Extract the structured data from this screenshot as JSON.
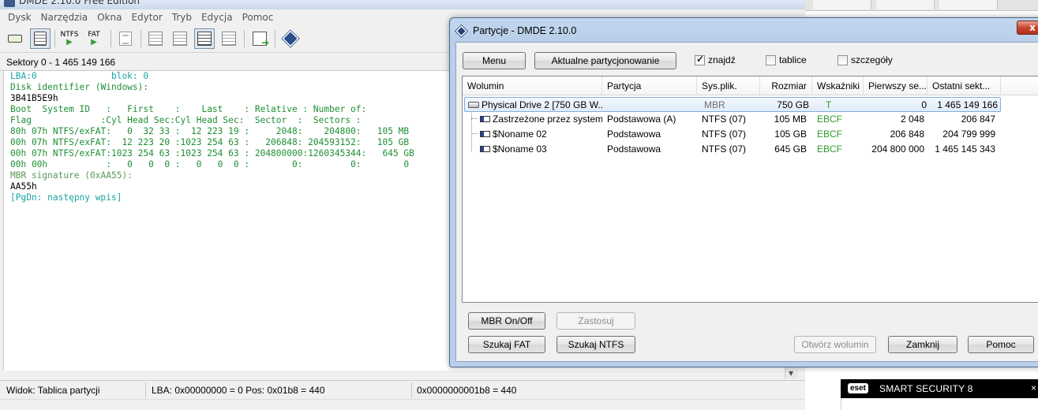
{
  "main": {
    "title": "DMDE 2.10.0 Free Edition",
    "menu": [
      "Dysk",
      "Narzędzia",
      "Okna",
      "Edytor",
      "Tryb",
      "Edycja",
      "Pomoc"
    ],
    "toolbar": {
      "ntfs": "NTFS",
      "fat": "FAT"
    },
    "sectors": "Sektory 0 - 1 465 149 166",
    "hex_lines": [
      "LBA:0              blok: 0",
      "Disk identifier (Windows):",
      "3B41B5E9h",
      "Boot  System ID   :   First    :    Last    : Relative : Number of:",
      "Flag             :Cyl Head Sec:Cyl Head Sec:  Sector  :  Sectors :",
      "80h 07h NTFS/exFAT:   0  32 33 :  12 223 19 :     2048:    204800:   105 MB",
      "00h 07h NTFS/exFAT:  12 223 20 :1023 254 63 :   206848: 204593152:   105 GB",
      "00h 07h NTFS/exFAT:1023 254 63 :1023 254 63 : 204800000:1260345344:   645 GB",
      "00h 00h           :   0   0  0 :   0   0  0 :        0:         0:        0",
      "MBR signature (0xAA55):",
      "AA55h",
      "[PgDn: następny wpis]"
    ],
    "status": {
      "view": "Widok: Tablica partycji",
      "lba": "LBA: 0x00000000 = 0  Pos: 0x01b8 = 440",
      "offset": "0x0000000001b8 = 440"
    }
  },
  "eset": {
    "logo": "eset",
    "name": "SMART SECURITY 8",
    "close": "×"
  },
  "dialog": {
    "title": "Partycje - DMDE 2.10.0",
    "close": "x",
    "menu_button": "Menu",
    "current_partitioning_button": "Aktualne partycjonowanie",
    "checkboxes": [
      {
        "label": "znajdź",
        "checked": true
      },
      {
        "label": "tablice",
        "checked": false
      },
      {
        "label": "szczegóły",
        "checked": false
      }
    ],
    "columns": [
      "Wolumin",
      "Partycja",
      "Sys.plik.",
      "Rozmiar",
      "Wskaźniki",
      "Pierwszy se...",
      "Ostatni sekt..."
    ],
    "rows": [
      {
        "volume": "Physical Drive 2 [750 GB W...",
        "partition": "",
        "fs": "MBR",
        "size": "750 GB",
        "flags": "T",
        "first": "0",
        "last": "1 465 149 166"
      },
      {
        "volume": "Zastrzeżone przez system",
        "partition": "Podstawowa (A)",
        "fs": "NTFS (07)",
        "size": "105 MB",
        "flags": "EBCF",
        "first": "2 048",
        "last": "206 847"
      },
      {
        "volume": "$Noname 02",
        "partition": "Podstawowa",
        "fs": "NTFS (07)",
        "size": "105 GB",
        "flags": "EBCF",
        "first": "206 848",
        "last": "204 799 999"
      },
      {
        "volume": "$Noname 03",
        "partition": "Podstawowa",
        "fs": "NTFS (07)",
        "size": "645 GB",
        "flags": "EBCF",
        "first": "204 800 000",
        "last": "1 465 145 343"
      }
    ],
    "buttons": {
      "mbr_onoff": "MBR On/Off",
      "apply": "Zastosuj",
      "search_fat": "Szukaj FAT",
      "search_ntfs": "Szukaj NTFS",
      "open_volume": "Otwórz wolumin",
      "close": "Zamknij",
      "help": "Pomoc"
    }
  }
}
